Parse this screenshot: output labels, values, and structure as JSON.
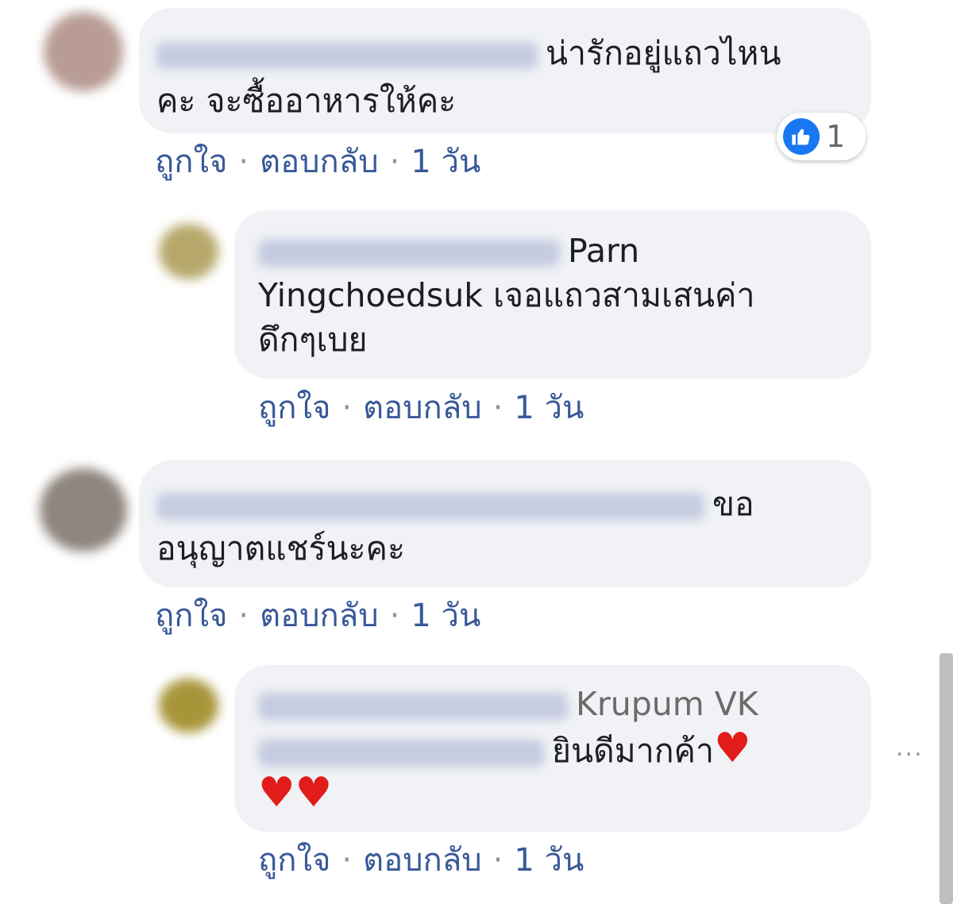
{
  "comments": [
    {
      "text_line1": "น่ารักอยู่แถวไหน",
      "text_line2": "คะ จะซื้ออาหารให้คะ",
      "actions": {
        "like": "ถูกใจ",
        "sep": "·",
        "reply": "ตอบกลับ",
        "time": "1 วัน"
      },
      "reaction_count": "1",
      "reaction_icon": "like-thumb-icon"
    },
    {
      "text_line1": "Parn",
      "text_line2": "Yingchoedsuk เจอแถวสามเสนค่า",
      "text_line3": "ดึกๆเบย",
      "actions": {
        "like": "ถูกใจ",
        "sep": "·",
        "reply": "ตอบกลับ",
        "time": "1 วัน"
      }
    },
    {
      "text_line1": "ขอ",
      "text_line2": "อนุญาตแชร์นะคะ",
      "actions": {
        "like": "ถูกใจ",
        "sep": "·",
        "reply": "ตอบกลับ",
        "time": "1 วัน"
      }
    },
    {
      "text_line1": "Krupum VK",
      "text_line2": "ยินดีมากค้า",
      "hearts": "♥ ♥ ♥",
      "actions": {
        "like": "ถูกใจ",
        "sep": "·",
        "reply": "ตอบกลับ",
        "time": "1 วัน"
      }
    }
  ],
  "more_menu": "...",
  "colors": {
    "link": "#385898",
    "bubble": "#f0f2f5",
    "like": "#1877f2",
    "heart": "#e21b1b"
  }
}
